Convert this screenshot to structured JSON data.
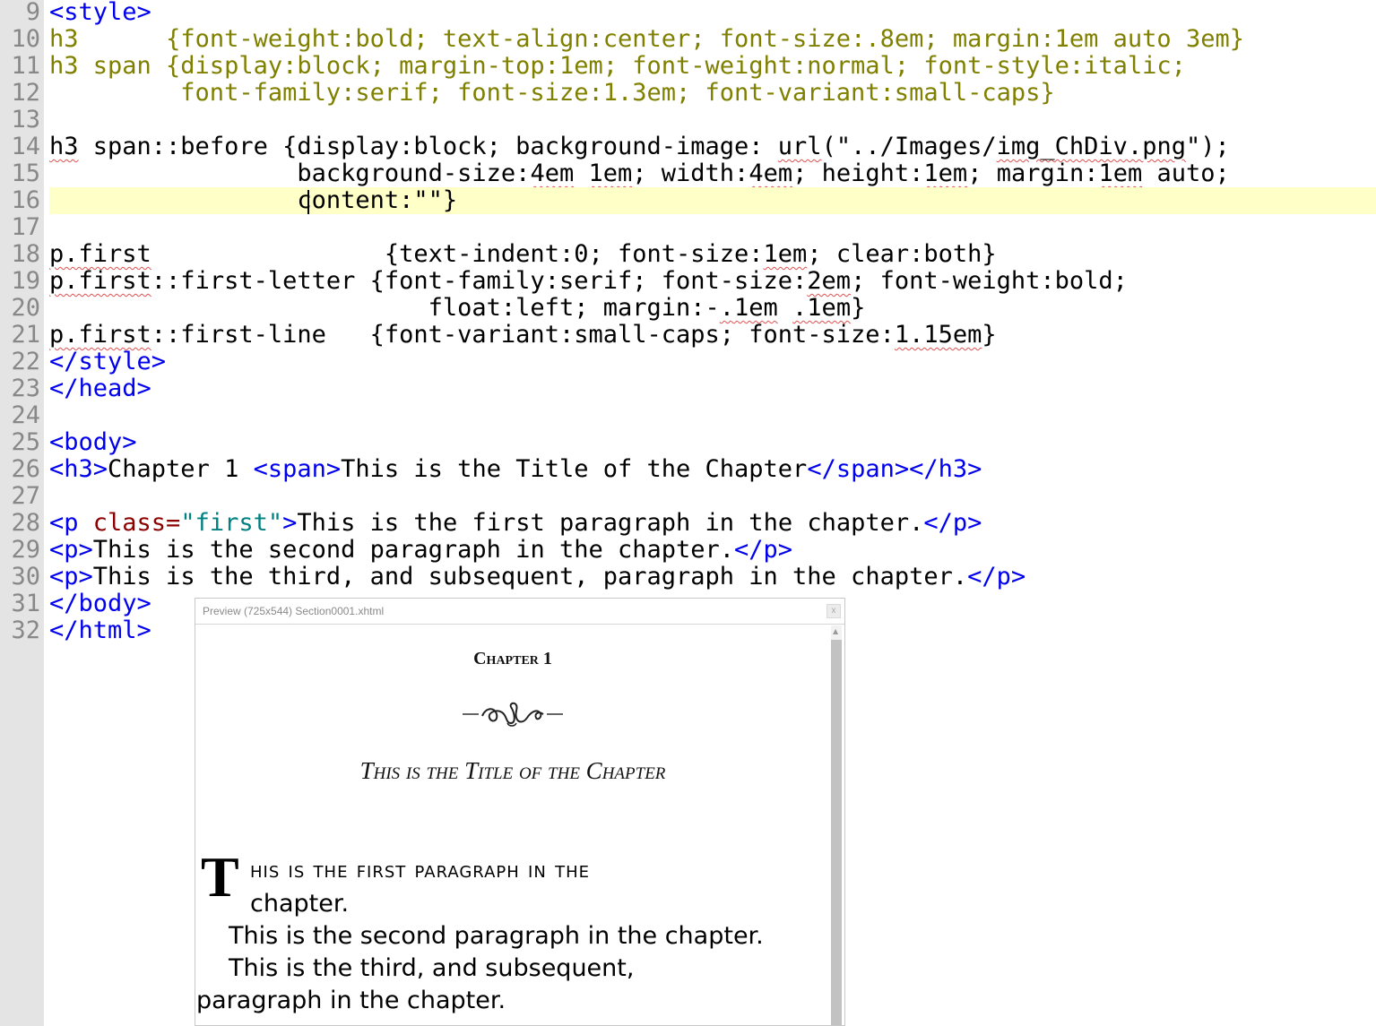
{
  "editor": {
    "current_line": 16,
    "lines": [
      {
        "number": "9",
        "tokens": [
          {
            "t": "<style>",
            "c": "tag"
          }
        ]
      },
      {
        "number": "10",
        "tokens": [
          {
            "t": "h3",
            "c": "css"
          },
          {
            "t": "      ",
            "c": "plain"
          },
          {
            "t": "{font-weight:bold; text-align:center; font-size:.8em; margin:1em auto 3em}",
            "c": "css"
          }
        ]
      },
      {
        "number": "11",
        "tokens": [
          {
            "t": "h3 span {display:block; margin-top:1em; font-weight:normal; font-style:italic;",
            "c": "css"
          }
        ]
      },
      {
        "number": "12",
        "tokens": [
          {
            "t": "         font-family:serif; font-size:1.3em; font-variant:small-caps}",
            "c": "css"
          }
        ]
      },
      {
        "number": "13",
        "tokens": []
      },
      {
        "number": "14",
        "tokens": [
          {
            "t": "h3",
            "c": "plain",
            "squig": true
          },
          {
            "t": " span::before {display:block; background-image: ",
            "c": "plain"
          },
          {
            "t": "url",
            "c": "plain",
            "squig": true
          },
          {
            "t": "(\"../Images/",
            "c": "plain"
          },
          {
            "t": "img_ChDiv.png",
            "c": "plain",
            "squig": true
          },
          {
            "t": "\");",
            "c": "plain"
          }
        ]
      },
      {
        "number": "15",
        "tokens": [
          {
            "t": "                 background-size:",
            "c": "plain"
          },
          {
            "t": "4em",
            "c": "plain",
            "squig": true
          },
          {
            "t": " ",
            "c": "plain"
          },
          {
            "t": "1em",
            "c": "plain",
            "squig": true
          },
          {
            "t": "; width:",
            "c": "plain"
          },
          {
            "t": "4em",
            "c": "plain",
            "squig": true
          },
          {
            "t": "; height:",
            "c": "plain"
          },
          {
            "t": "1em",
            "c": "plain",
            "squig": true
          },
          {
            "t": "; margin:",
            "c": "plain"
          },
          {
            "t": "1em",
            "c": "plain",
            "squig": true
          },
          {
            "t": " auto;",
            "c": "plain"
          }
        ]
      },
      {
        "number": "16",
        "tokens": [
          {
            "t": "                 content:\"\"}",
            "c": "plain"
          }
        ]
      },
      {
        "number": "17",
        "tokens": []
      },
      {
        "number": "18",
        "tokens": [
          {
            "t": "p.first",
            "c": "plain",
            "squig": true
          },
          {
            "t": "                {text-indent:0; font-size:",
            "c": "plain"
          },
          {
            "t": "1em",
            "c": "plain",
            "squig": true
          },
          {
            "t": "; clear:both}",
            "c": "plain"
          }
        ]
      },
      {
        "number": "19",
        "tokens": [
          {
            "t": "p.first",
            "c": "plain",
            "squig": true
          },
          {
            "t": "::first-letter {font-family:serif; font-size:",
            "c": "plain"
          },
          {
            "t": "2em",
            "c": "plain",
            "squig": true
          },
          {
            "t": "; font-weight:bold;",
            "c": "plain"
          }
        ]
      },
      {
        "number": "20",
        "tokens": [
          {
            "t": "                          float:left; margin:-",
            "c": "plain"
          },
          {
            "t": ".1em",
            "c": "plain",
            "squig": true
          },
          {
            "t": " ",
            "c": "plain"
          },
          {
            "t": ".1em",
            "c": "plain",
            "squig": true
          },
          {
            "t": "}",
            "c": "plain"
          }
        ]
      },
      {
        "number": "21",
        "tokens": [
          {
            "t": "p.first",
            "c": "plain",
            "squig": true
          },
          {
            "t": "::first-line   {font-variant:small-caps; font-size:",
            "c": "plain"
          },
          {
            "t": "1.15em",
            "c": "plain",
            "squig": true
          },
          {
            "t": "}",
            "c": "plain"
          }
        ]
      },
      {
        "number": "22",
        "tokens": [
          {
            "t": "</style>",
            "c": "tag"
          }
        ]
      },
      {
        "number": "23",
        "tokens": [
          {
            "t": "</head>",
            "c": "tag"
          }
        ]
      },
      {
        "number": "24",
        "tokens": []
      },
      {
        "number": "25",
        "tokens": [
          {
            "t": "<body>",
            "c": "tag"
          }
        ]
      },
      {
        "number": "26",
        "tokens": [
          {
            "t": "<h3>",
            "c": "tag"
          },
          {
            "t": "Chapter 1 ",
            "c": "plain"
          },
          {
            "t": "<span>",
            "c": "tag"
          },
          {
            "t": "This is the Title of the Chapter",
            "c": "plain"
          },
          {
            "t": "</span></h3>",
            "c": "tag"
          }
        ]
      },
      {
        "number": "27",
        "tokens": []
      },
      {
        "number": "28",
        "tokens": [
          {
            "t": "<p ",
            "c": "tag"
          },
          {
            "t": "class=",
            "c": "attr"
          },
          {
            "t": "\"first\"",
            "c": "val"
          },
          {
            "t": ">",
            "c": "tag"
          },
          {
            "t": "This is the first paragraph in the chapter.",
            "c": "plain"
          },
          {
            "t": "</p>",
            "c": "tag"
          }
        ]
      },
      {
        "number": "29",
        "tokens": [
          {
            "t": "<p>",
            "c": "tag"
          },
          {
            "t": "This is the second paragraph in the chapter.",
            "c": "plain"
          },
          {
            "t": "</p>",
            "c": "tag"
          }
        ]
      },
      {
        "number": "30",
        "tokens": [
          {
            "t": "<p>",
            "c": "tag"
          },
          {
            "t": "This is the third, and subsequent, paragraph in the chapter.",
            "c": "plain"
          },
          {
            "t": "</p>",
            "c": "tag"
          }
        ]
      },
      {
        "number": "31",
        "tokens": [
          {
            "t": "</body>",
            "c": "tag"
          }
        ]
      },
      {
        "number": "32",
        "tokens": [
          {
            "t": "</html>",
            "c": "tag"
          }
        ]
      }
    ]
  },
  "preview": {
    "window_title": "Preview (725x544) Section0001.xhtml",
    "close_label": "x",
    "chapter_heading": "Chapter 1",
    "chapter_title": "This is the Title of the Chapter",
    "p1_drop_cap": "T",
    "p1_line1": "his is the first paragraph in the",
    "p1_line2": "chapter.",
    "p2": "This is the second paragraph in the chapter.",
    "p3_line1": "This is the third, and subsequent,",
    "p3_line2": "paragraph in the chapter."
  },
  "icons": {
    "ornament": "chapter-divider-ornament-icon",
    "scroll_up": "scroll-up-arrow-icon"
  },
  "colors": {
    "tag": "#0000ee",
    "css": "#808000",
    "attr": "#8b0000",
    "val": "#008080",
    "current_line_highlight": "#ffffc8"
  }
}
